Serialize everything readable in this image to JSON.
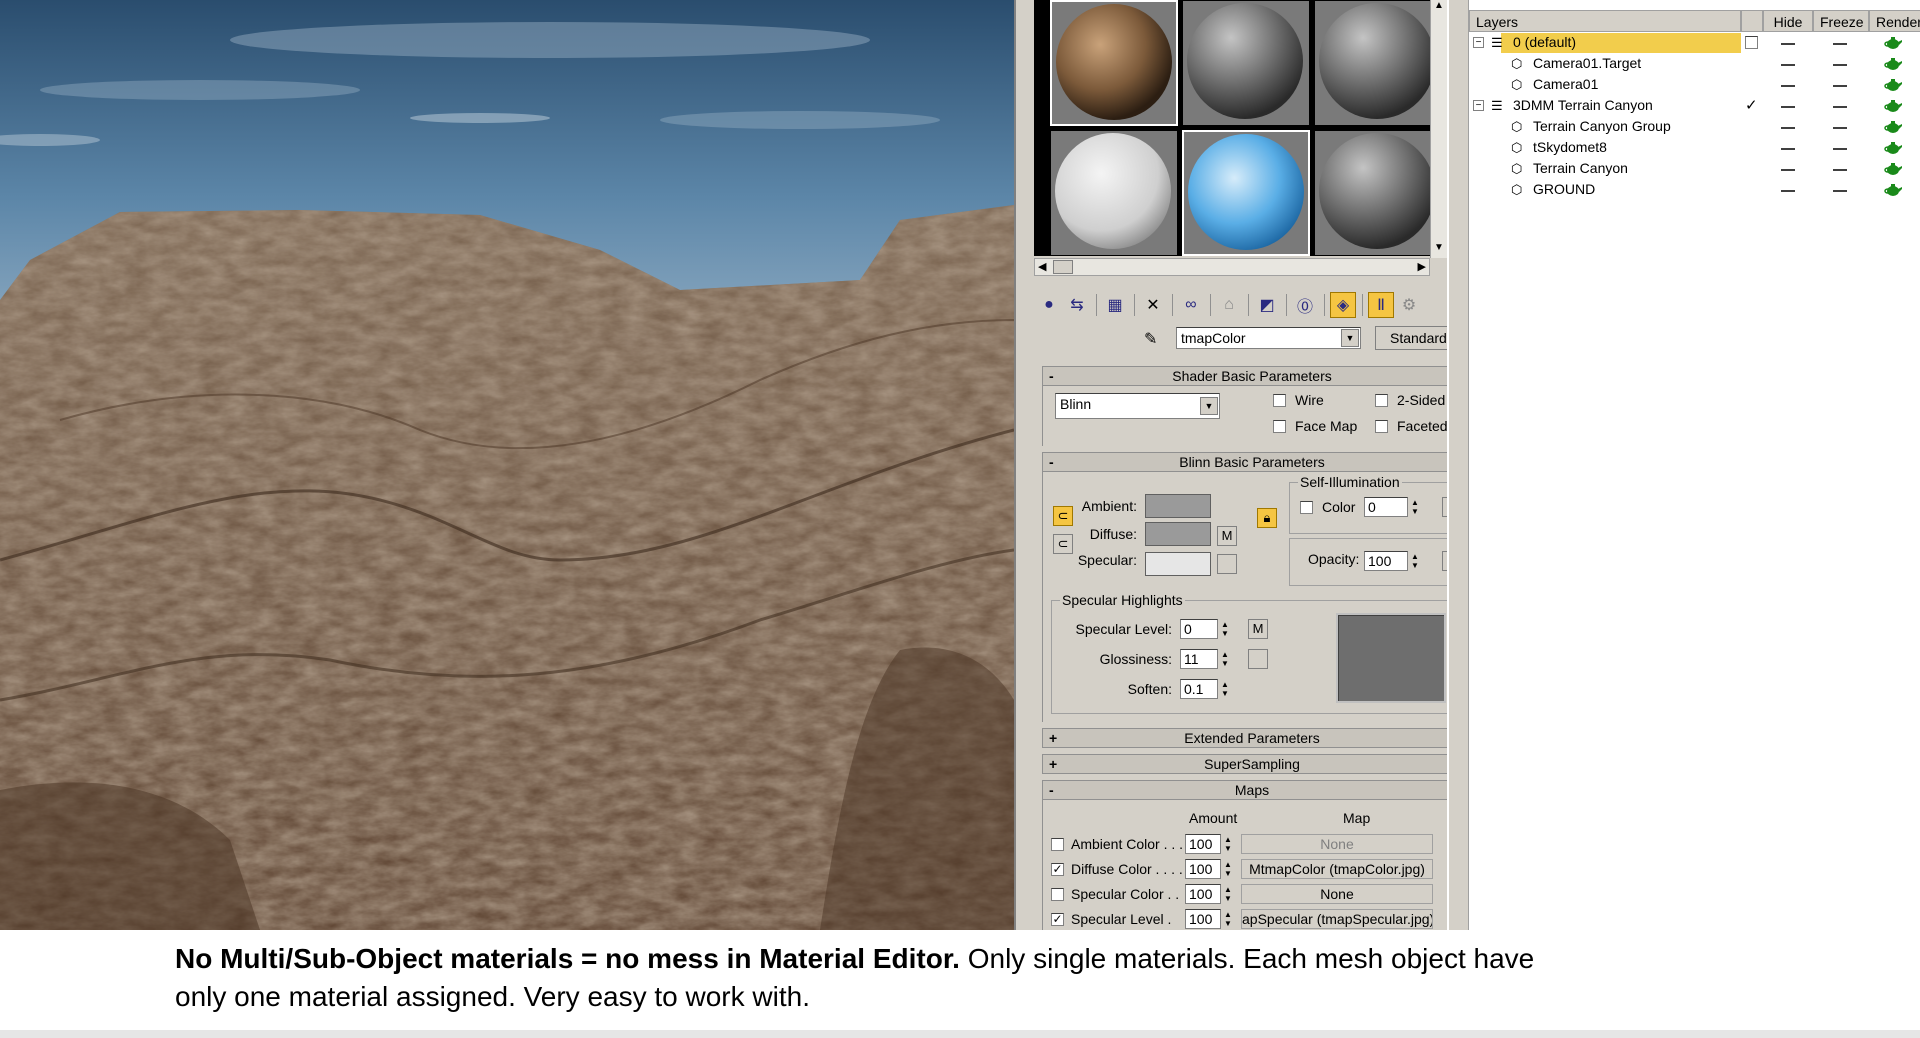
{
  "material_editor": {
    "material_name": "tmapColor",
    "material_type": "Standard",
    "shader_rollout": {
      "title": "Shader Basic Parameters",
      "toggle": "-",
      "shader": "Blinn",
      "wire": "Wire",
      "two_sided": "2-Sided",
      "face_map": "Face Map",
      "faceted": "Faceted"
    },
    "blinn_rollout": {
      "title": "Blinn Basic Parameters",
      "toggle": "-",
      "ambient": "Ambient:",
      "diffuse": "Diffuse:",
      "specular": "Specular:",
      "map_btn": "M",
      "self_illum_title": "Self-Illumination",
      "color_label": "Color",
      "color_value": "0",
      "opacity_label": "Opacity:",
      "opacity_value": "100",
      "spec_highlights_title": "Specular Highlights",
      "spec_level_label": "Specular Level:",
      "spec_level_value": "0",
      "glossiness_label": "Glossiness:",
      "glossiness_value": "11",
      "soften_label": "Soften:",
      "soften_value": "0.1",
      "colors": {
        "ambient": "#9a9a9a",
        "diffuse": "#9a9a9a",
        "specular": "#e6e6e6"
      }
    },
    "extended_rollout": {
      "title": "Extended Parameters",
      "toggle": "+"
    },
    "supersampling_rollout": {
      "title": "SuperSampling",
      "toggle": "+"
    },
    "maps_rollout": {
      "title": "Maps",
      "toggle": "-",
      "col_amount": "Amount",
      "col_map": "Map",
      "rows": [
        {
          "label": "Ambient Color . . .",
          "amount": "100",
          "map": "None",
          "checked": false
        },
        {
          "label": "Diffuse Color . . . .",
          "amount": "100",
          "map": "MtmapColor (tmapColor.jpg)",
          "checked": true
        },
        {
          "label": "Specular Color . .",
          "amount": "100",
          "map": "None",
          "checked": false
        },
        {
          "label": "Specular Level .",
          "amount": "100",
          "map": "apSpecular (tmapSpecular.jpg)",
          "checked": true
        }
      ]
    }
  },
  "layers": {
    "headers": {
      "layers": "Layers",
      "hide": "Hide",
      "freeze": "Freeze",
      "render": "Render"
    },
    "rows": [
      {
        "name": "0 (default)",
        "level": 0,
        "type": "layer",
        "selected": true,
        "current": false
      },
      {
        "name": "Camera01.Target",
        "level": 1,
        "type": "object",
        "selected": false,
        "current": false
      },
      {
        "name": "Camera01",
        "level": 1,
        "type": "object",
        "selected": false,
        "current": false
      },
      {
        "name": "3DMM Terrain Canyon",
        "level": 0,
        "type": "layer",
        "selected": false,
        "current": true
      },
      {
        "name": "Terrain Canyon Group",
        "level": 1,
        "type": "object",
        "selected": false,
        "current": false
      },
      {
        "name": "tSkydomet8",
        "level": 1,
        "type": "object",
        "selected": false,
        "current": false
      },
      {
        "name": "Terrain Canyon",
        "level": 1,
        "type": "object",
        "selected": false,
        "current": false
      },
      {
        "name": "GROUND",
        "level": 1,
        "type": "object",
        "selected": false,
        "current": false
      }
    ]
  },
  "caption": {
    "bold": "No Multi/Sub-Object materials = no mess in Material Editor.",
    "rest": " Only single materials. Each mesh object have",
    "line2": "only one material assigned. Very easy to work with."
  }
}
